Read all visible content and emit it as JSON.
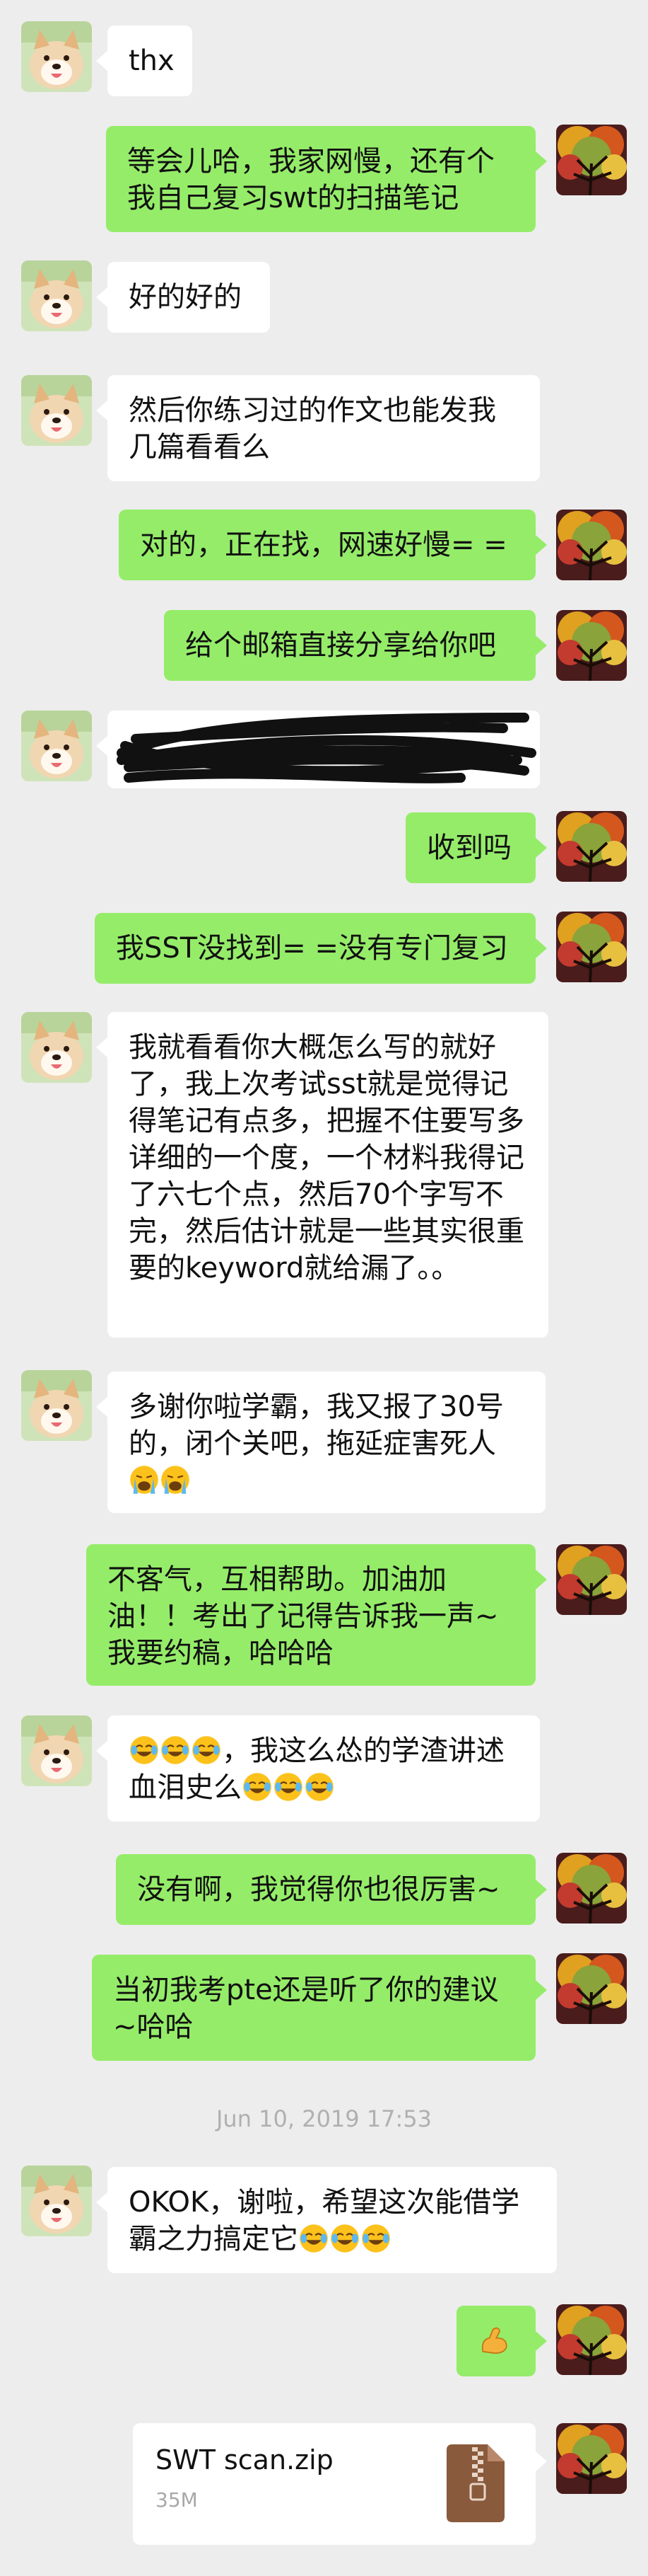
{
  "messages": [
    {
      "from": "other",
      "text": "thx"
    },
    {
      "from": "me",
      "text": "等会儿哈，我家网慢，还有个我自己复习swt的扫描笔记"
    },
    {
      "from": "other",
      "text": "好的好的"
    },
    {
      "from": "other",
      "text": "然后你练习过的作文也能发我几篇看看么"
    },
    {
      "from": "me",
      "text": "对的，正在找，网速好慢= ="
    },
    {
      "from": "me",
      "text": "给个邮箱直接分享给你吧"
    },
    {
      "from": "other",
      "text": ""
    },
    {
      "from": "me",
      "text": "收到吗"
    },
    {
      "from": "me",
      "text": "我SST没找到= =没有专门复习"
    },
    {
      "from": "other",
      "text": "我就看看你大概怎么写的就好了，我上次考试sst就是觉得记得笔记有点多，把握不住要写多详细的一个度，一个材料我得记了六七个点，然后70个字写不完，然后估计就是一些其实很重要的keyword就给漏了。。"
    },
    {
      "from": "other",
      "text": "多谢你啦学霸，我又报了30号的，闭个关吧，拖延症害死人"
    },
    {
      "from": "me",
      "text": "不客气，互相帮助。加油加油！！考出了记得告诉我一声~我要约稿，哈哈哈"
    },
    {
      "from": "other",
      "text": "，我这么怂的学渣讲述血泪史么"
    },
    {
      "from": "me",
      "text": "没有啊，我觉得你也很厉害~"
    },
    {
      "from": "me",
      "text": "当初我考pte还是听了你的建议~哈哈"
    },
    {
      "from": "other",
      "text": "OKOK，谢啦，希望这次能借学霸之力搞定它"
    },
    {
      "from": "me",
      "text": ""
    }
  ],
  "timestamp": "Jun 10, 2019 17:53",
  "file": {
    "name": "SWT scan.zip",
    "size": "35M"
  },
  "icons": {
    "other_avatar": "shiba-dog-avatar",
    "my_avatar": "autumn-tree-avatar",
    "laugh_cry": "face-with-tears-of-joy-icon",
    "crying": "loudly-crying-face-icon",
    "muscle": "flexed-biceps-icon",
    "file": "zip-file-icon"
  },
  "colors": {
    "background": "#ededed",
    "incoming_bubble": "#ffffff",
    "outgoing_bubble": "#95ec69",
    "timestamp": "#b0b0b0"
  }
}
